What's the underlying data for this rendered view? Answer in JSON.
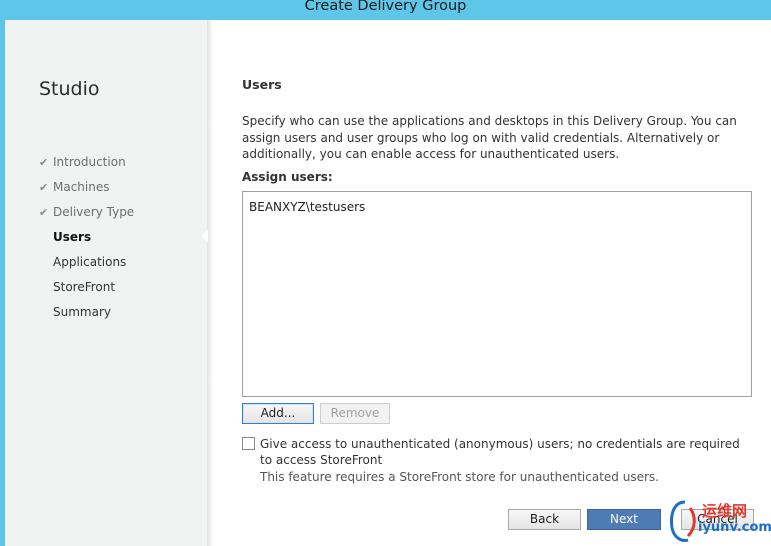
{
  "window": {
    "title": "Create Delivery Group"
  },
  "sidebar": {
    "app_name": "Studio",
    "steps": [
      {
        "label": "Introduction",
        "state": "done"
      },
      {
        "label": "Machines",
        "state": "done"
      },
      {
        "label": "Delivery Type",
        "state": "done"
      },
      {
        "label": "Users",
        "state": "current"
      },
      {
        "label": "Applications",
        "state": "pending"
      },
      {
        "label": "StoreFront",
        "state": "pending"
      },
      {
        "label": "Summary",
        "state": "pending"
      }
    ]
  },
  "main": {
    "section_title": "Users",
    "description": "Specify who can use the applications and desktops in this Delivery Group. You can assign users and user groups who log on with valid credentials. Alternatively or additionally, you can enable access for unauthenticated users.",
    "assign_label": "Assign users:",
    "users": [
      "BEANXYZ\\testusers"
    ],
    "add_button": "Add...",
    "remove_button": "Remove",
    "anon_checkbox_label": "Give access to unauthenticated (anonymous) users; no credentials are required to access StoreFront",
    "anon_checkbox_checked": false,
    "anon_note": "This feature requires a StoreFront store for unauthenticated users."
  },
  "footer": {
    "back_label": "Back",
    "next_label": "Next",
    "cancel_label": "Cancel"
  },
  "watermark": {
    "line1": "运维网",
    "line2": "iyunv.com"
  },
  "colors": {
    "titlebar": "#5ec6e8",
    "sidebar": "#f1f2f2",
    "next_button": "#4f7bb4"
  }
}
